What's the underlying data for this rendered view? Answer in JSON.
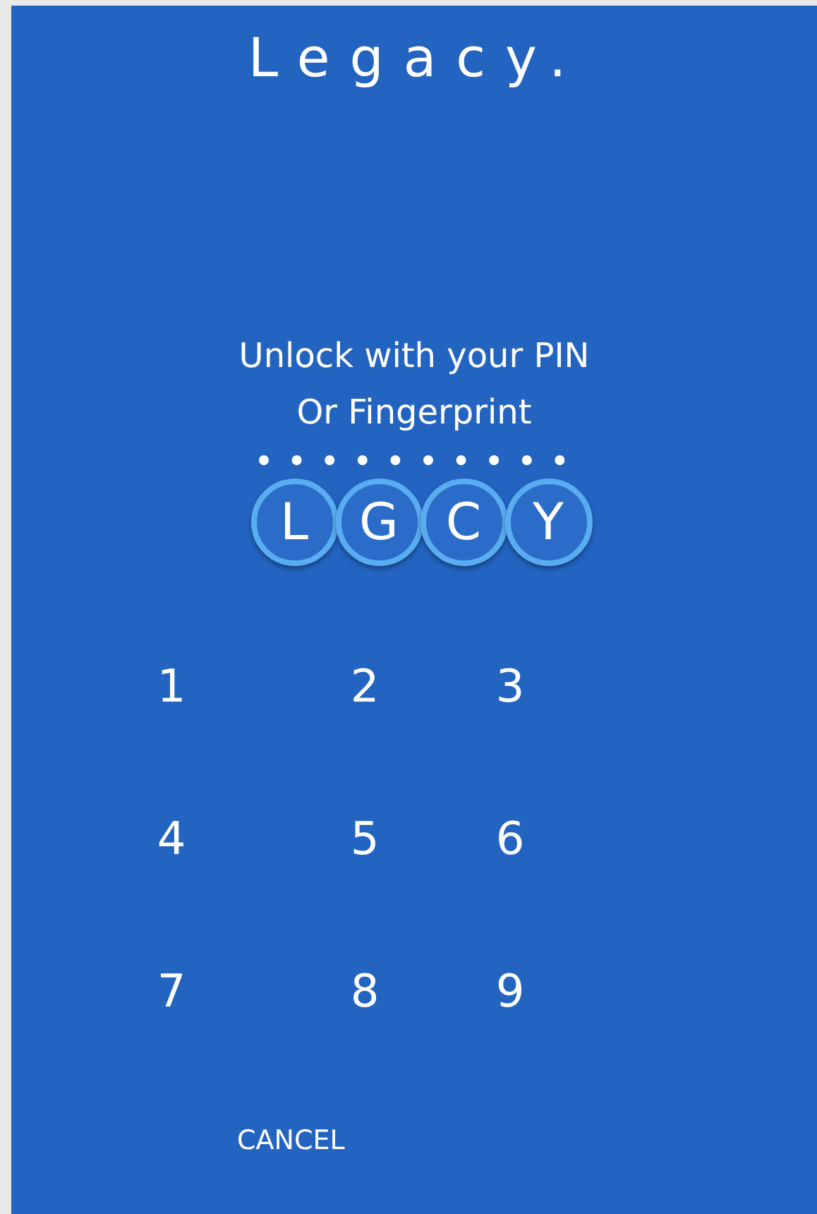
{
  "app_title": "Legacy.",
  "prompt": [
    "Unlock with your PIN",
    "Or Fingerprint"
  ],
  "logo_letters": [
    "L",
    "G",
    "C",
    "Y"
  ],
  "keypad": [
    "1",
    "2",
    "3",
    "4",
    "5",
    "6",
    "7",
    "8",
    "9"
  ],
  "cancel_button": "CANCEL"
}
